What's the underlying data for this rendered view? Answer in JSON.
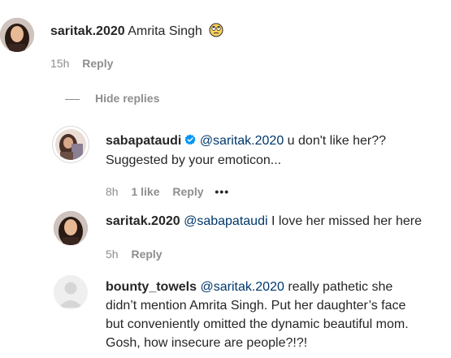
{
  "comments": [
    {
      "username": "saritak.2020",
      "text": "Amrita Singh",
      "time": "15h",
      "reply_label": "Reply",
      "emoji_icon": "rolling-eyes-emoji"
    }
  ],
  "hide_replies_label": "Hide replies",
  "replies": [
    {
      "username": "sabapataudi",
      "mention": "@saritak.2020",
      "text_line1": "u don't like her??",
      "text_line2": "Suggested by your emoticon...",
      "time": "8h",
      "likes": "1 like",
      "reply_label": "Reply",
      "more_label": "•••"
    },
    {
      "username": "saritak.2020",
      "mention": "@sabapataudi",
      "text": "I love her missed her here",
      "time": "5h",
      "reply_label": "Reply"
    },
    {
      "username": "bounty_towels",
      "mention": "@saritak.2020",
      "text_line1": "really pathetic she",
      "text_line2": "didn’t mention Amrita Singh. Put her daughter’s face",
      "text_line3": "but conveniently omitted the dynamic beautiful mom.",
      "text_line4": "Gosh, how insecure are people?!?!"
    }
  ],
  "colors": {
    "text": "#262626",
    "meta": "#8e8e8e",
    "mention": "#00376b",
    "verified": "#0095f6"
  }
}
